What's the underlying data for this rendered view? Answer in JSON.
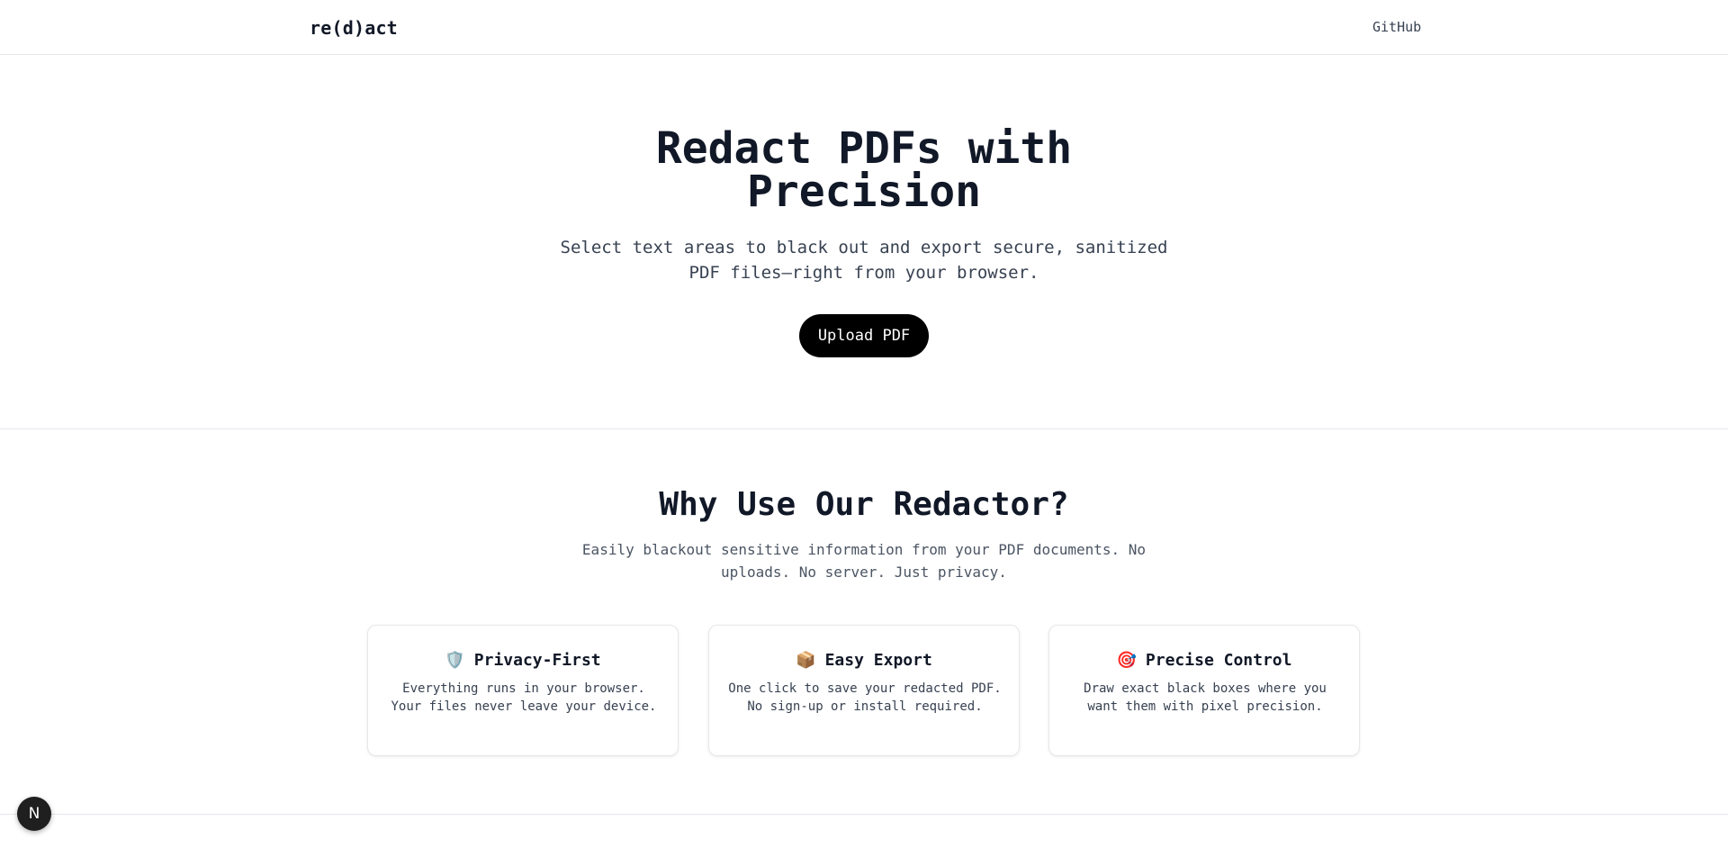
{
  "header": {
    "logo": "re(d)act",
    "github_label": "GitHub"
  },
  "hero": {
    "title": "Redact PDFs with Precision",
    "subtitle": "Select text areas to black out and export secure, sanitized PDF files—right from your browser.",
    "upload_label": "Upload PDF"
  },
  "why": {
    "title": "Why Use Our Redactor?",
    "subtitle": "Easily blackout sensitive information from your PDF documents. No uploads. No server. Just privacy."
  },
  "features": [
    {
      "icon": "shield-icon",
      "emoji": "🛡️",
      "title": "Privacy-First",
      "description": "Everything runs in your browser. Your files never leave your device."
    },
    {
      "icon": "package-icon",
      "emoji": "📦",
      "title": "Easy Export",
      "description": "One click to save your redacted PDF. No sign-up or install required."
    },
    {
      "icon": "target-icon",
      "emoji": "🎯",
      "title": "Precise Control",
      "description": "Draw exact black boxes where you want them with pixel precision."
    }
  ],
  "dev_badge": {
    "icon": "nextjs-icon",
    "label": "N"
  }
}
